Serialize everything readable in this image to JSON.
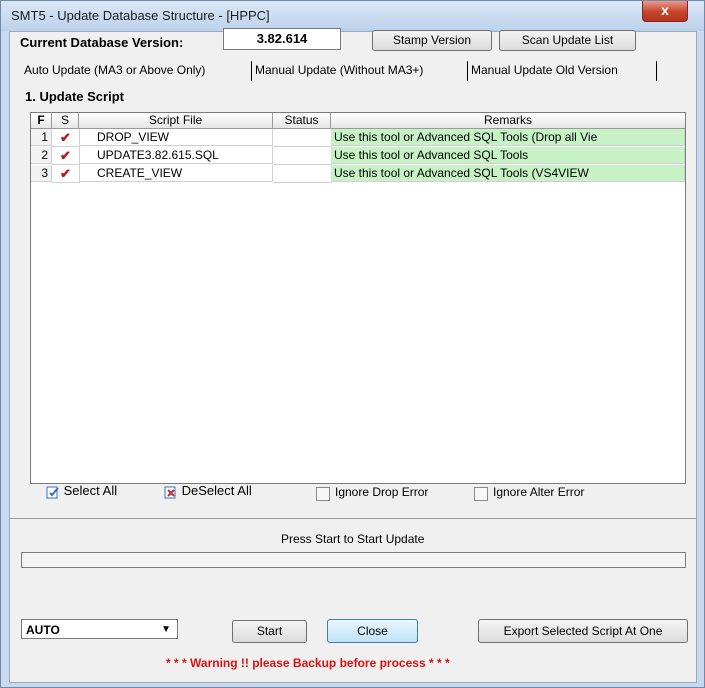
{
  "window": {
    "title": "SMT5 - Update Database Structure - [HPPC]",
    "close_glyph": "x"
  },
  "version": {
    "label": "Current Database Version:",
    "value": "3.82.614"
  },
  "buttons": {
    "stamp": "Stamp Version",
    "scan": "Scan Update List",
    "start": "Start",
    "close": "Close",
    "export": "Export Selected Script At One"
  },
  "tabs": [
    "Auto Update (MA3 or Above Only)",
    "Manual Update (Without MA3+)",
    "Manual Update Old Version"
  ],
  "group_label": "1. Update Script",
  "grid": {
    "headers": {
      "f": "F",
      "s": "S",
      "script": "Script File",
      "status": "Status",
      "remarks": "Remarks"
    },
    "rows": [
      {
        "num": "1",
        "check": "✔",
        "script": "DROP_VIEW",
        "status": "",
        "remarks": "Use this tool or Advanced SQL Tools (Drop all Vie"
      },
      {
        "num": "2",
        "check": "✔",
        "script": "UPDATE3.82.615.SQL",
        "status": "",
        "remarks": "Use this tool or Advanced SQL Tools"
      },
      {
        "num": "3",
        "check": "✔",
        "script": "CREATE_VIEW",
        "status": "",
        "remarks": "Use this tool or Advanced SQL Tools (VS4VIEW"
      }
    ]
  },
  "selection": {
    "select_all": "Select All",
    "deselect_all": "DeSelect All",
    "ignore_drop": "Ignore Drop Error",
    "ignore_alter": "Ignore Alter Error"
  },
  "status_text": "Press Start to Start Update",
  "mode": {
    "value": "AUTO"
  },
  "warning": "* * * Warning !! please Backup before process * * *",
  "colors": {
    "remarks_bg": "#c6f2c6",
    "warning": "#e01010",
    "check": "#b31b1b"
  }
}
